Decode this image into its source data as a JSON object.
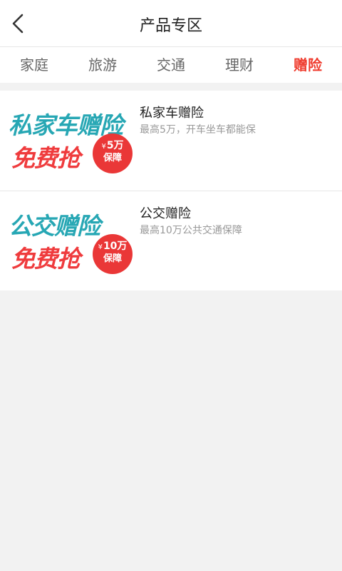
{
  "header": {
    "title": "产品专区",
    "back_icon": "chevron-left-icon"
  },
  "tabs": [
    {
      "label": "家庭",
      "active": false
    },
    {
      "label": "旅游",
      "active": false
    },
    {
      "label": "交通",
      "active": false
    },
    {
      "label": "理财",
      "active": false
    },
    {
      "label": "赠险",
      "active": true
    }
  ],
  "colors": {
    "accent": "#ef3b2d",
    "banner_teal": "#27a7b4",
    "banner_red": "#ef3b3d",
    "badge_red": "#ea3737",
    "background": "#f2f2f2"
  },
  "products": [
    {
      "banner_title": "私家车赠险",
      "banner_cta": "免费抢",
      "badge_currency": "¥",
      "badge_amount": "5万",
      "badge_label": "保障",
      "name": "私家车赠险",
      "desc": "最高5万，开车坐车都能保"
    },
    {
      "banner_title": "公交赠险",
      "banner_cta": "免费抢",
      "badge_currency": "¥",
      "badge_amount": "10万",
      "badge_label": "保障",
      "name": "公交赠险",
      "desc": "最高10万公共交通保障"
    }
  ]
}
